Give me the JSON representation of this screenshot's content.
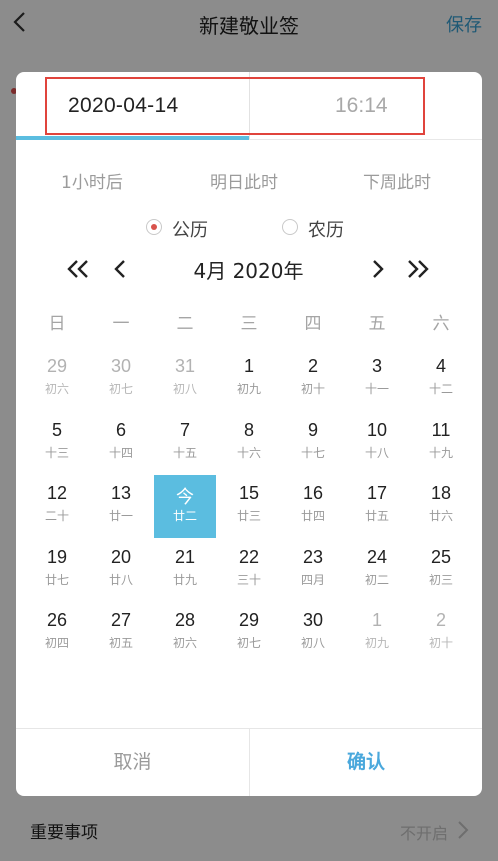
{
  "app": {
    "title": "新建敬业签",
    "save_label": "保存",
    "important_label": "重要事项",
    "important_value": "不开启"
  },
  "picker": {
    "date_tab": "2020-04-14",
    "time_tab": "16:14",
    "quick": [
      "1小时后",
      "明日此时",
      "下周此时"
    ],
    "calendar_solar": "公历",
    "calendar_lunar": "农历",
    "selected_calendar": "公历",
    "month_label": "4月 2020年",
    "weekdays": [
      "日",
      "一",
      "二",
      "三",
      "四",
      "五",
      "六"
    ],
    "cancel_label": "取消",
    "confirm_label": "确认",
    "days": [
      {
        "d": "29",
        "l": "初六",
        "muted": true
      },
      {
        "d": "30",
        "l": "初七",
        "muted": true
      },
      {
        "d": "31",
        "l": "初八",
        "muted": true
      },
      {
        "d": "1",
        "l": "初九"
      },
      {
        "d": "2",
        "l": "初十"
      },
      {
        "d": "3",
        "l": "十一"
      },
      {
        "d": "4",
        "l": "十二"
      },
      {
        "d": "5",
        "l": "十三"
      },
      {
        "d": "6",
        "l": "十四"
      },
      {
        "d": "7",
        "l": "十五"
      },
      {
        "d": "8",
        "l": "十六"
      },
      {
        "d": "9",
        "l": "十七"
      },
      {
        "d": "10",
        "l": "十八"
      },
      {
        "d": "11",
        "l": "十九"
      },
      {
        "d": "12",
        "l": "二十"
      },
      {
        "d": "13",
        "l": "廿一"
      },
      {
        "d": "今",
        "l": "廿二",
        "today": true
      },
      {
        "d": "15",
        "l": "廿三"
      },
      {
        "d": "16",
        "l": "廿四"
      },
      {
        "d": "17",
        "l": "廿五"
      },
      {
        "d": "18",
        "l": "廿六"
      },
      {
        "d": "19",
        "l": "廿七"
      },
      {
        "d": "20",
        "l": "廿八"
      },
      {
        "d": "21",
        "l": "廿九"
      },
      {
        "d": "22",
        "l": "三十"
      },
      {
        "d": "23",
        "l": "四月"
      },
      {
        "d": "24",
        "l": "初二"
      },
      {
        "d": "25",
        "l": "初三"
      },
      {
        "d": "26",
        "l": "初四"
      },
      {
        "d": "27",
        "l": "初五"
      },
      {
        "d": "28",
        "l": "初六"
      },
      {
        "d": "29",
        "l": "初七"
      },
      {
        "d": "30",
        "l": "初八"
      },
      {
        "d": "1",
        "l": "初九",
        "muted": true
      },
      {
        "d": "2",
        "l": "初十",
        "muted": true
      }
    ]
  },
  "colors": {
    "accent": "#5bbde0",
    "confirm": "#4aa8dc",
    "radio_selected": "#d8534c",
    "highlight_box": "#e0443c"
  }
}
